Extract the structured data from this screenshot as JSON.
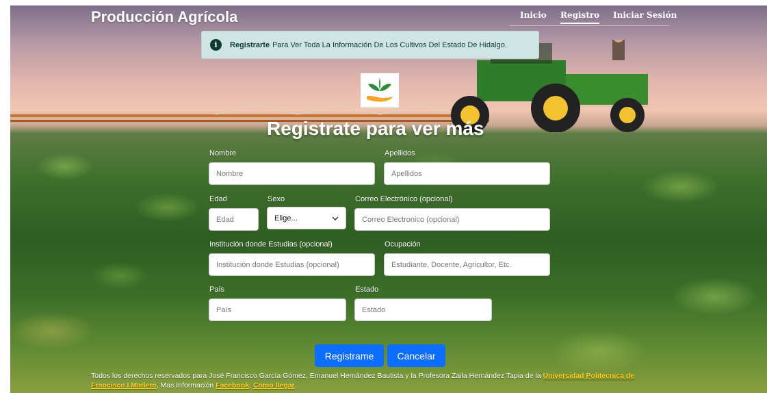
{
  "brand": "Producción Agrícola",
  "nav": {
    "inicio": "Inicio",
    "registro": "Registro",
    "login": "Iniciar Sesión"
  },
  "alert": {
    "bold": "Registrarte",
    "text": "Para Ver Toda La Información De Los Cultivos Del Estado De Hidalgo.",
    "icon": "info-icon"
  },
  "title": "Registrate para ver más",
  "form": {
    "nombre": {
      "label": "Nombre",
      "placeholder": "Nombre"
    },
    "apellidos": {
      "label": "Apellidos",
      "placeholder": "Apellidos"
    },
    "edad": {
      "label": "Edad",
      "placeholder": "Edad"
    },
    "sexo": {
      "label": "Sexo",
      "value": "Elige..."
    },
    "correo": {
      "label": "Correo Electrónico (opcional)",
      "placeholder": "Correo Electronico (opcional)"
    },
    "institucion": {
      "label": "Institución donde Estudias (opcional)",
      "placeholder": "Institución donde Estudias (opcional)"
    },
    "ocupacion": {
      "label": "Ocupación",
      "placeholder": "Estudiante, Docente, Agricultor, Etc."
    },
    "pais": {
      "label": "País",
      "placeholder": "País"
    },
    "estado": {
      "label": "Estado",
      "placeholder": "Estado"
    }
  },
  "buttons": {
    "submit": "Registrame",
    "cancel": "Cancelar",
    "color": "#0d6efd"
  },
  "footer": {
    "text1": "Todos los derechos reservados para José Francisco García Gómez, Emanuel Hernández Bautista y la Profesora Zaila Hernández Tapia de la",
    "link_uni": "Universidad Politecnica de Francisco I Madero",
    "text2": ", Mas Información",
    "link_fb": "Facebook",
    "link_map": "Como llegar",
    "end": ".",
    "link_color": "#ffd21f"
  }
}
